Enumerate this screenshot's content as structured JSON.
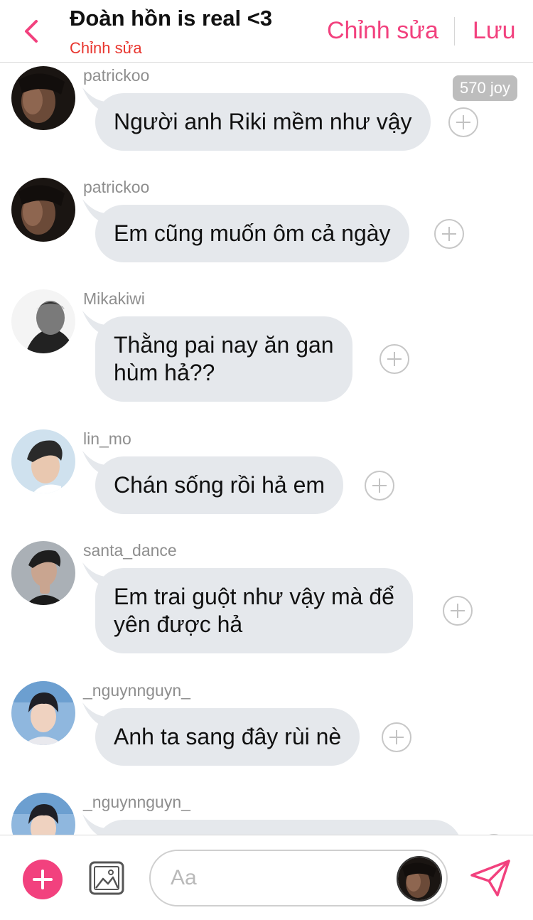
{
  "header": {
    "title": "Đoàn hồn is real <3",
    "subtitle": "Chỉnh sửa",
    "edit_label": "Chỉnh sửa",
    "save_label": "Lưu"
  },
  "colors": {
    "accent": "#f2417e",
    "subtitle_red": "#e8362f",
    "bubble_bg": "#e5e8ec"
  },
  "messages": [
    {
      "user": "patrickoo",
      "text": "Người anh Riki mềm như vậy",
      "badge": "570 joy"
    },
    {
      "user": "patrickoo",
      "text": "Em cũng muốn ôm cả ngày"
    },
    {
      "user": "Mikakiwi",
      "text_lines": [
        "Thằng pai nay ăn gan",
        "hùm hả??"
      ]
    },
    {
      "user": "lin_mo",
      "text": "Chán sống rồi hả em"
    },
    {
      "user": "santa_dance",
      "text_lines": [
        "Em trai guột như vậy mà để",
        "yên được hả"
      ]
    },
    {
      "user": "_nguynnguyn_",
      "text": "Anh ta sang đây rùi nè"
    },
    {
      "user": "_nguynnguyn_",
      "text": ""
    }
  ],
  "composer": {
    "placeholder": "Aa"
  },
  "icons": {
    "back": "chevron-left-icon",
    "add": "plus-icon",
    "image": "image-icon",
    "react": "add-reaction-icon",
    "send": "send-icon"
  }
}
